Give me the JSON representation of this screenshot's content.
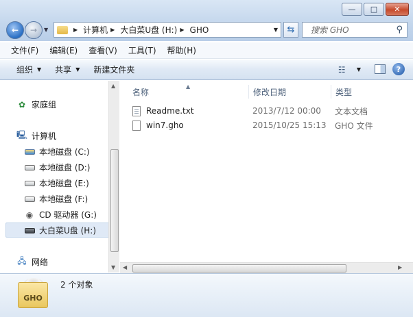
{
  "window": {
    "minimize": "—",
    "maximize": "□",
    "close": "✕"
  },
  "address": {
    "segments": [
      "计算机",
      "大白菜U盘 (H:)",
      "GHO"
    ]
  },
  "search": {
    "placeholder": "搜索 GHO"
  },
  "menu": [
    "文件(F)",
    "编辑(E)",
    "查看(V)",
    "工具(T)",
    "帮助(H)"
  ],
  "toolbar": {
    "organize": "组织",
    "share": "共享",
    "new_folder": "新建文件夹",
    "help": "?"
  },
  "nav": {
    "homegroup": "家庭组",
    "computer": "计算机",
    "drives": [
      "本地磁盘 (C:)",
      "本地磁盘 (D:)",
      "本地磁盘 (E:)",
      "本地磁盘 (F:)",
      "CD 驱动器 (G:)",
      "大白菜U盘 (H:)"
    ],
    "selected_drive": "大白菜U盘 (H:)",
    "network": "网络"
  },
  "columns": {
    "name": "名称",
    "date": "修改日期",
    "type": "类型"
  },
  "files": [
    {
      "name": "Readme.txt",
      "date": "2013/7/12 00:00",
      "type": "文本文档",
      "icon": "text-file-icon"
    },
    {
      "name": "win7.gho",
      "date": "2015/10/25 15:13",
      "type": "GHO 文件",
      "icon": "blank-file-icon"
    }
  ],
  "details": {
    "icon_label": "GHO",
    "count": "2 个对象"
  },
  "colors": {
    "selection": "#dfe9f6",
    "toolbar": "#dfe9f5",
    "accent": "#2a6fc4"
  }
}
